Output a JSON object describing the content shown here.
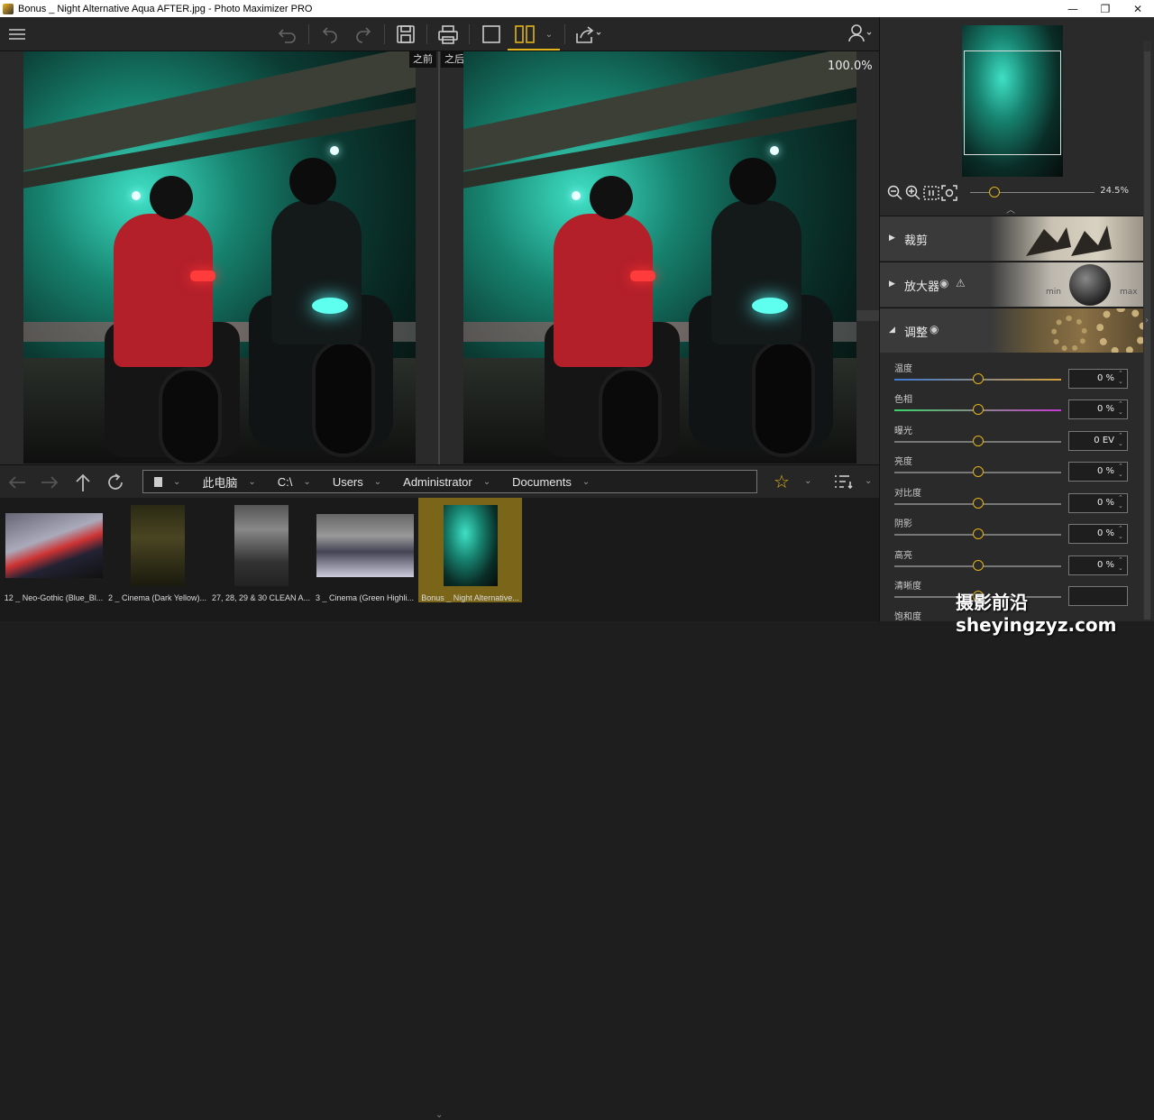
{
  "window": {
    "title": "Bonus _ Night Alternative Aqua AFTER.jpg - Photo Maximizer PRO",
    "minimize": "—",
    "maximize": "❐",
    "close": "✕"
  },
  "viewer": {
    "before_label": "之前",
    "after_label": "之后",
    "zoom": "100.0%"
  },
  "path": {
    "crumbs": [
      "此电脑",
      "C:\\",
      "Users",
      "Administrator",
      "Documents"
    ]
  },
  "thumbnails": [
    {
      "caption": "12 _ Neo-Gothic (Blue_Bl..."
    },
    {
      "caption": "2 _ Cinema (Dark Yellow)..."
    },
    {
      "caption": "27, 28, 29 & 30 CLEAN A..."
    },
    {
      "caption": "3 _ Cinema (Green Highli..."
    },
    {
      "caption": "Bonus _ Night Alternative..."
    }
  ],
  "panel": {
    "zoom_value": "24.5%",
    "sections": {
      "crop": "裁剪",
      "enlarger": "放大器",
      "adjust": "调整"
    },
    "adjustments": [
      {
        "label": "温度",
        "value": "0 %"
      },
      {
        "label": "色相",
        "value": "0 %"
      },
      {
        "label": "曝光",
        "value": "0 EV"
      },
      {
        "label": "亮度",
        "value": "0 %"
      },
      {
        "label": "对比度",
        "value": "0 %"
      },
      {
        "label": "阴影",
        "value": "0 %"
      },
      {
        "label": "高亮",
        "value": "0 %"
      },
      {
        "label": "清晰度",
        "value": ""
      },
      {
        "label": "饱和度",
        "value": ""
      }
    ],
    "dial_min": "min",
    "dial_max": "max"
  },
  "watermark": "摄影前沿 sheyingzyz.com",
  "colors": {
    "accent": "#e3b31a",
    "selected_thumb": "#7a6518"
  }
}
